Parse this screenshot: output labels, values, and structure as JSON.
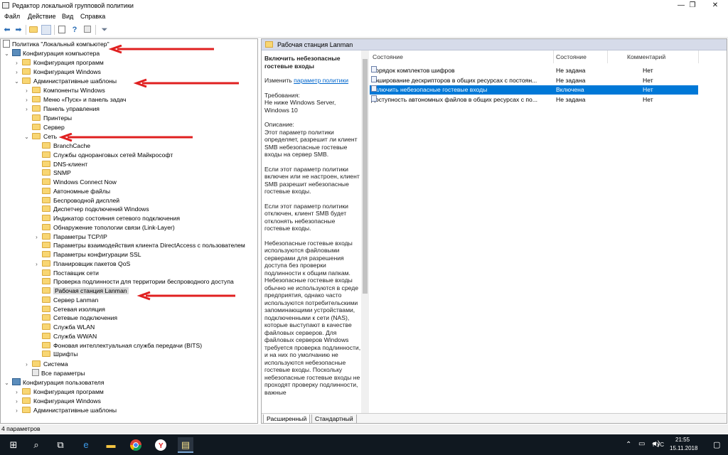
{
  "window": {
    "title": "Редактор локальной групповой политики",
    "controls": {
      "minimize": "—",
      "maximize": "❐",
      "close": "✕"
    }
  },
  "menu": [
    "Файл",
    "Действие",
    "Вид",
    "Справка"
  ],
  "toolbar_icons": [
    "back-arrow-icon",
    "forward-arrow-icon",
    "up-folder-icon",
    "show-tree-icon",
    "export-icon",
    "help-icon",
    "properties-icon",
    "filter-icon"
  ],
  "tree": {
    "root": "Политика \"Локальный компьютер\"",
    "computer_config": "Конфигурация компьютера",
    "program_config": "Конфигурация программ",
    "windows_config": "Конфигурация Windows",
    "admin_templates": "Административные шаблоны",
    "windows_components": "Компоненты Windows",
    "start_menu": "Меню «Пуск» и панель задач",
    "control_panel": "Панель управления",
    "printers": "Принтеры",
    "server": "Сервер",
    "network": "Сеть",
    "network_children": [
      "BranchCache",
      "Службы одноранговых сетей Майкрософт",
      "DNS-клиент",
      "SNMP",
      "Windows Connect Now",
      "Автономные файлы",
      "Беспроводной дисплей",
      "Диспетчер подключений Windows",
      "Индикатор состояния сетевого подключения",
      "Обнаружение топологии связи (Link-Layer)",
      "Параметры TCP/IP",
      "Параметры взаимодействия клиента DirectAccess с пользователем",
      "Параметры конфигурации SSL",
      "Планировщик пакетов QoS",
      "Поставщик сети",
      "Проверка подлинности для территории беспроводного доступа",
      "Рабочая станция Lanman",
      "Сервер Lanman",
      "Сетевая изоляция",
      "Сетевые подключения",
      "Служба WLAN",
      "Служба WWAN",
      "Фоновая интеллектуальная служба передачи (BITS)",
      "Шрифты"
    ],
    "system": "Система",
    "all_settings": "Все параметры",
    "user_config": "Конфигурация пользователя",
    "user_program_config": "Конфигурация программ",
    "user_windows_config": "Конфигурация Windows",
    "user_admin_templates": "Административные шаблоны"
  },
  "right": {
    "header": "Рабочая станция Lanman",
    "description": {
      "title": "Включить небезопасные гостевые входы",
      "edit_prefix": "Изменить",
      "edit_link": "параметр политики",
      "requirements_label": "Требования:",
      "requirements": "Не ниже Windows Server, Windows 10",
      "desc_label": "Описание:",
      "p1": "Этот параметр политики определяет, разрешит ли клиент SMB небезопасные гостевые входы на сервер SMB.",
      "p2": "Если этот параметр политики включен или не настроен, клиент SMB разрешит небезопасные гостевые входы.",
      "p3": "Если этот параметр политики отключен, клиент SMB будет отклонять небезопасные гостевые входы.",
      "p4": "Небезопасные гостевые входы используются файловыми серверами для разрешения доступа без проверки подлинности к общим папкам. Небезопасные гостевые входы обычно не используются в среде предприятия, однако часто используются потребительскими запоминающими устройствами, подключенными к сети (NAS), которые выступают в качестве файловых серверов. Для файловых серверов Windows требуется проверка подлинности, и на них по умолчанию не используются небезопасные гостевые входы. Поскольку небезопасные гостевые входы не проходят проверку подлинности, важные"
    },
    "columns": {
      "setting": "Состояние",
      "state": "Состояние",
      "comment": "Комментарий"
    },
    "rows": [
      {
        "name": "Порядок комплектов шифров",
        "state": "Не задана",
        "comment": "Нет"
      },
      {
        "name": "Кэширование дескрипторов в общих ресурсах с постоян...",
        "state": "Не задана",
        "comment": "Нет"
      },
      {
        "name": "Включить небезопасные гостевые входы",
        "state": "Включена",
        "comment": "Нет"
      },
      {
        "name": "Доступность автономных файлов в общих ресурсах с по...",
        "state": "Не задана",
        "comment": "Нет"
      }
    ],
    "tabs": [
      "Расширенный",
      "Стандартный"
    ]
  },
  "status": "4 параметров",
  "taskbar": {
    "lang": "РУС",
    "time": "21:55",
    "date": "15.11.2018"
  },
  "colors": {
    "selection": "#0078d7",
    "annotation_arrow": "#e02020"
  }
}
